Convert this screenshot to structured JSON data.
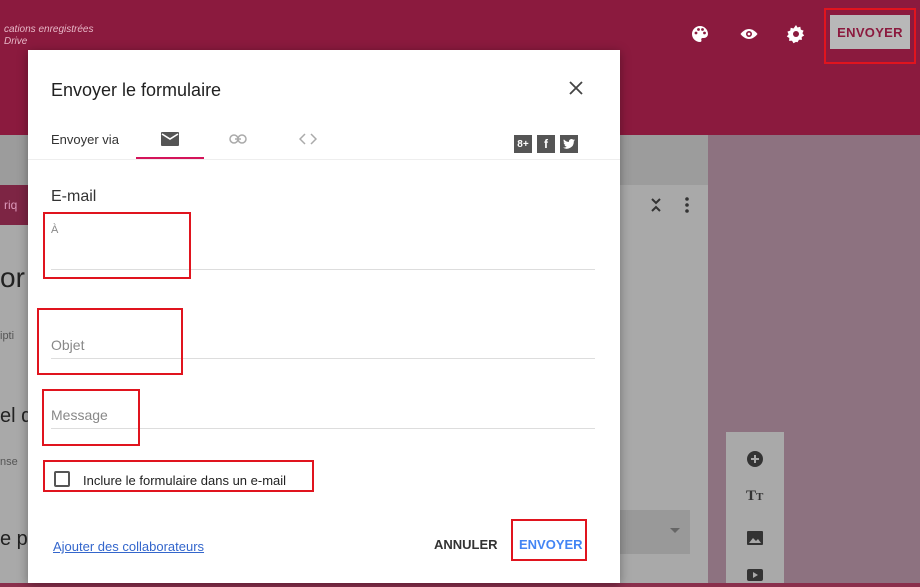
{
  "header": {
    "saved_text": "cations enregistrées",
    "saved_text_2": "Drive",
    "send_button": "ENVOYER"
  },
  "background": {
    "frag_heading": "or",
    "frag_desc": "ipti",
    "frag_label": "el d",
    "frag_answer": "nse",
    "frag_question": "e p",
    "frag_section": "riq"
  },
  "dialog": {
    "title": "Envoyer le formulaire",
    "send_via_label": "Envoyer via",
    "section_title": "E-mail",
    "to_label": "À",
    "subject_placeholder": "Objet",
    "message_placeholder": "Message",
    "include_label": "Inclure le formulaire dans un e-mail",
    "add_collaborators": "Ajouter des collaborateurs",
    "cancel": "ANNULER",
    "send": "ENVOYER"
  },
  "colors": {
    "brand": "#8b1a3e",
    "highlight": "#e0141e",
    "tab_accent": "#d4145a",
    "link": "#3366cc",
    "send_blue": "#4285f4"
  }
}
